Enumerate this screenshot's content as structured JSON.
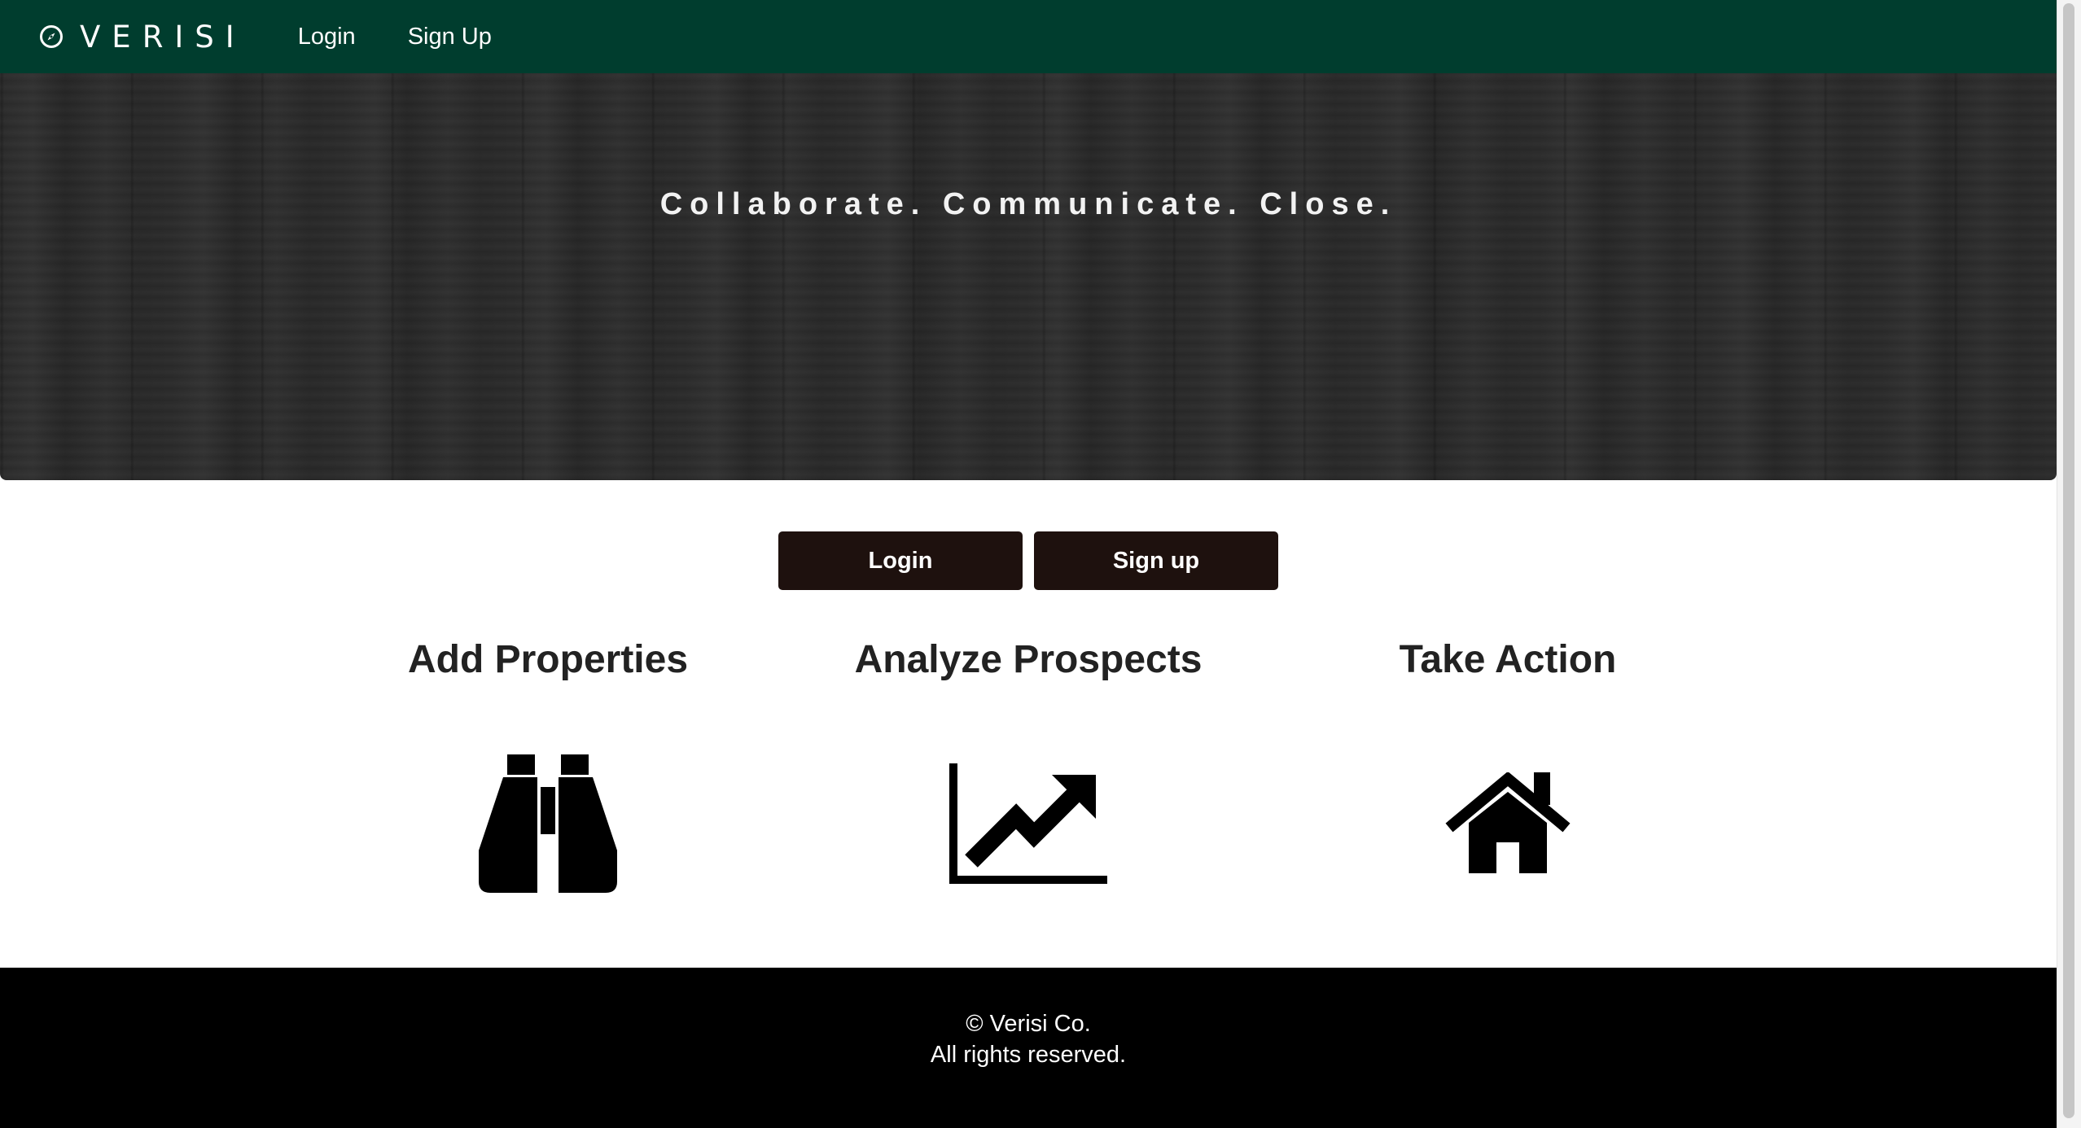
{
  "navbar": {
    "brand": "VERISI",
    "brand_icon": "compass-icon",
    "links": [
      {
        "label": "Login"
      },
      {
        "label": "Sign Up"
      }
    ],
    "background": "#003d2e"
  },
  "hero": {
    "tagline": "Collaborate. Communicate. Close."
  },
  "cta": {
    "login_label": "Login",
    "signup_label": "Sign up",
    "button_color": "#1e110e"
  },
  "features": [
    {
      "title": "Add Properties",
      "icon": "binoculars-icon"
    },
    {
      "title": "Analyze Prospects",
      "icon": "line-chart-icon"
    },
    {
      "title": "Take Action",
      "icon": "home-icon"
    }
  ],
  "footer": {
    "line1": "© Verisi Co.",
    "line2": "All rights reserved."
  }
}
